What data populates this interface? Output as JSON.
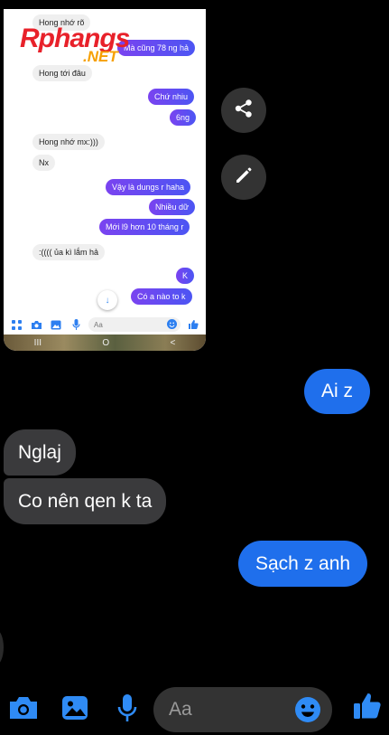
{
  "colors": {
    "accent": "#1f6fec",
    "incoming_bubble": "#3a3a3c",
    "composer_field": "#333333",
    "background": "#000000"
  },
  "shared_screenshot": {
    "watermark": {
      "main": "Rphangs",
      "suffix": ".NET"
    },
    "messages": [
      {
        "side": "in",
        "text": "Hong nhớ rõ"
      },
      {
        "side": "out",
        "text": "Mà cũng 78 ng hả"
      },
      {
        "side": "in",
        "text": "Hong tới đâu"
      },
      {
        "side": "out",
        "text": "Chứ nhiu"
      },
      {
        "side": "out",
        "text": "6ng"
      },
      {
        "side": "in",
        "text": "Hong nhớ mx:)))"
      },
      {
        "side": "in",
        "text": "Nx"
      },
      {
        "side": "out",
        "text": "Vậy là dungs r haha"
      },
      {
        "side": "out",
        "text": "Nhiều dữ"
      },
      {
        "side": "out",
        "text": "Mới l9 hơn 10 tháng r"
      },
      {
        "side": "in",
        "text": ":(((( ủa kì lắm hả"
      },
      {
        "side": "out",
        "text": "K"
      },
      {
        "side": "out",
        "text": "Có a nào to k"
      }
    ],
    "composer_placeholder": "Aa",
    "nav_bar": {
      "recent": "III",
      "home": "O",
      "back": "<"
    }
  },
  "chat": {
    "messages": [
      {
        "side": "out",
        "text": "Ai z"
      },
      {
        "side": "in",
        "text": "Nglaj"
      },
      {
        "side": "in",
        "text": "Co nên qen k ta"
      },
      {
        "side": "out",
        "text": "Sạch z anh"
      }
    ]
  },
  "composer": {
    "placeholder": "Aa",
    "icons": [
      "camera-icon",
      "image-icon",
      "microphone-icon",
      "emoji-icon",
      "thumbs-up-icon"
    ]
  },
  "floating_actions": [
    "share-icon",
    "edit-pencil-icon"
  ]
}
